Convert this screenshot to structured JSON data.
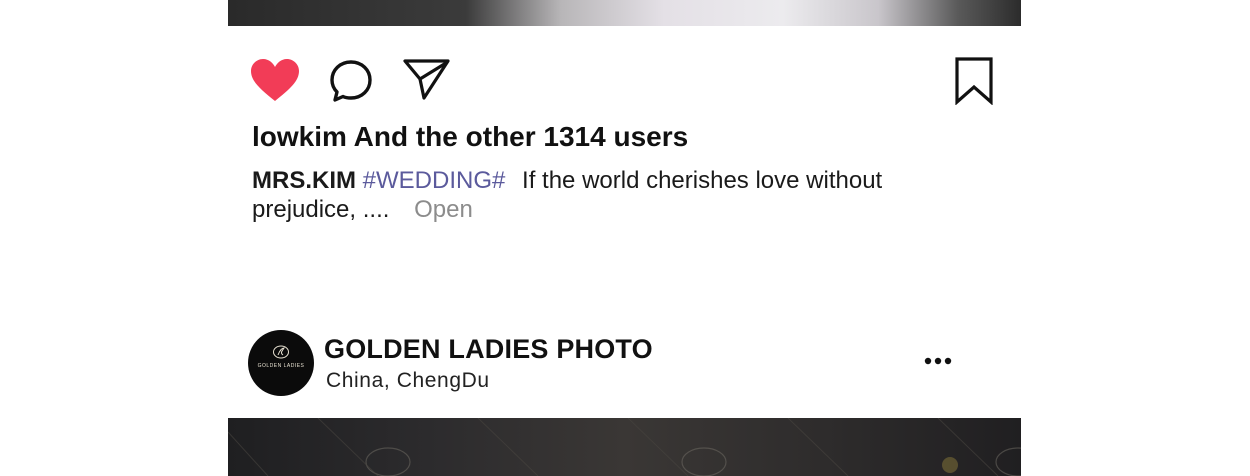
{
  "post_top": {
    "image_alt": "wedding photo (cropped)"
  },
  "actions": {
    "like_icon": "heart-filled-icon",
    "comment_icon": "comment-bubble-icon",
    "share_icon": "send-icon",
    "save_icon": "bookmark-icon",
    "like_color": "#f23c57"
  },
  "likes_text": "lowkim And the other 1314 users",
  "caption": {
    "author": "MRS.KIM",
    "hashtag": "#WEDDING#",
    "text": "If the world cherishes love without prejudice, ....",
    "open_label": "Open",
    "hashtag_color": "#5b5a9c"
  },
  "next_post": {
    "account_name": "GOLDEN LADIES PHOTO",
    "location": "China,  ChengDu",
    "avatar_text": "GOLDEN LADIES",
    "more_icon": "more-dots-icon"
  }
}
